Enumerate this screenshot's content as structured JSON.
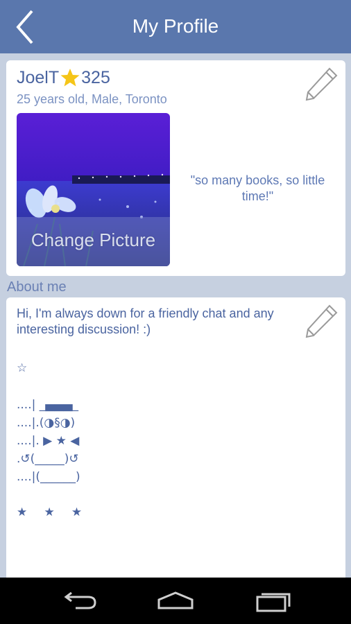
{
  "header": {
    "title": "My Profile"
  },
  "profile": {
    "username": "JoelT",
    "points": "325",
    "subtitle": "25 years old, Male, Toronto",
    "change_picture_label": "Change Picture",
    "quote": "\"so many books, so little time!\""
  },
  "about": {
    "section_label": "About me",
    "text": "Hi, I'm always down for a friendly chat and any interesting discussion! :)",
    "art_lines": [
      "☆",
      "....| _▄▄▄_",
      "....|.(◑§◑)",
      "....|. ▶ ★ ◀",
      ".↺(_____)↺",
      "....|(______)",
      "★   ★   ★"
    ]
  },
  "colors": {
    "header_bg": "#5a77ad",
    "page_bg": "#c6d0e0",
    "text_blue": "#4a64a0",
    "star_gold": "#f5c518"
  },
  "icons": {
    "back": "back-chevron-icon",
    "edit": "pencil-icon",
    "star": "star-icon",
    "nav_back": "back-arrow-icon",
    "nav_home": "home-icon",
    "nav_recents": "recent-apps-icon"
  }
}
